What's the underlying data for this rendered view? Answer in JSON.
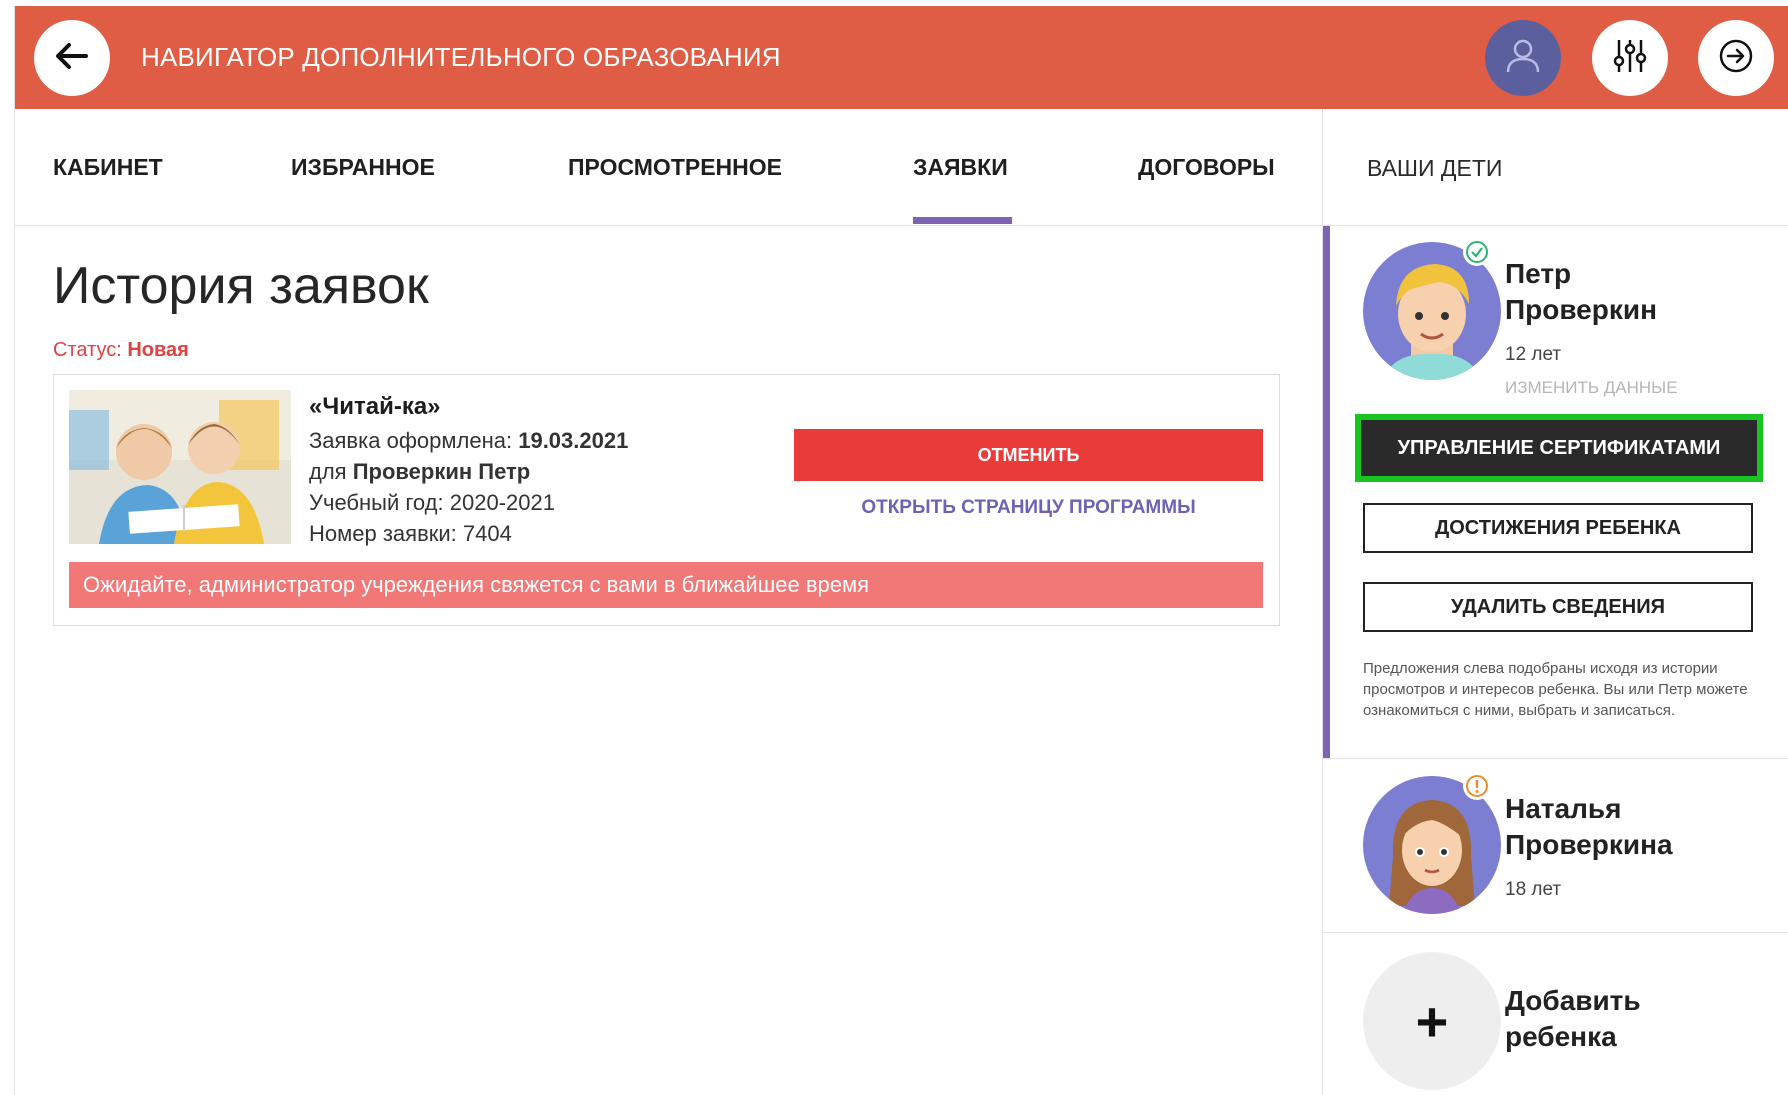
{
  "header": {
    "title": "НАВИГАТОР ДОПОЛНИТЕЛЬНОГО ОБРАЗОВАНИЯ",
    "back_icon": "arrow-left-icon",
    "user_icon": "user-icon",
    "filter_icon": "sliders-icon",
    "logout_icon": "logout-icon"
  },
  "tabs": [
    {
      "label": "КАБИНЕТ",
      "active": false
    },
    {
      "label": "ИЗБРАННОЕ",
      "active": false
    },
    {
      "label": "ПРОСМОТРЕННОЕ",
      "active": false
    },
    {
      "label": "ЗАЯВКИ",
      "active": true
    },
    {
      "label": "ДОГОВОРЫ",
      "active": false
    }
  ],
  "right_header": {
    "label": "ВАШИ ДЕТИ"
  },
  "main": {
    "title": "История заявок",
    "status_label": "Статус:",
    "status_value": "Новая"
  },
  "application": {
    "program_title": "«Читай-ка»",
    "issued_label": "Заявка оформлена:",
    "issued_date": "19.03.2021",
    "for_label": "для",
    "child_name": "Проверкин Петр",
    "year_text": "Учебный год: 2020-2021",
    "number_text": "Номер заявки: 7404",
    "cancel_label": "ОТМЕНИТЬ",
    "open_label": "ОТКРЫТЬ СТРАНИЦУ ПРОГРАММЫ",
    "notice": "Ожидайте, администратор учреждения свяжется с вами в ближайшее время"
  },
  "children": [
    {
      "first_name": "Петр",
      "last_name": "Проверкин",
      "age": "12 лет",
      "edit_label": "ИЗМЕНИТЬ ДАННЫЕ",
      "badge": "check-icon",
      "active": true
    },
    {
      "first_name": "Наталья",
      "last_name": "Проверкина",
      "age": "18 лет",
      "badge": "warning-icon",
      "active": false
    }
  ],
  "child_actions": {
    "certificates": "УПРАВЛЕНИЕ СЕРТИФИКАТАМИ",
    "achievements": "ДОСТИЖЕНИЯ РЕБЕНКА",
    "delete": "УДАЛИТЬ СВЕДЕНИЯ",
    "hint": "Предложения слева подобраны исходя из истории просмотров и интересов ребенка. Вы или Петр можете ознакомиться с ними, выбрать и записаться."
  },
  "add_child": {
    "line1": "Добавить",
    "line2": "ребенка",
    "icon_glyph": "+"
  },
  "colors": {
    "header_bg": "#e05d45",
    "accent_purple": "#7d63b2",
    "cancel_red": "#ea3b3b",
    "notice_bg": "#f27777",
    "highlight_green": "#18c41f",
    "dark_button": "#2a2a2a"
  }
}
